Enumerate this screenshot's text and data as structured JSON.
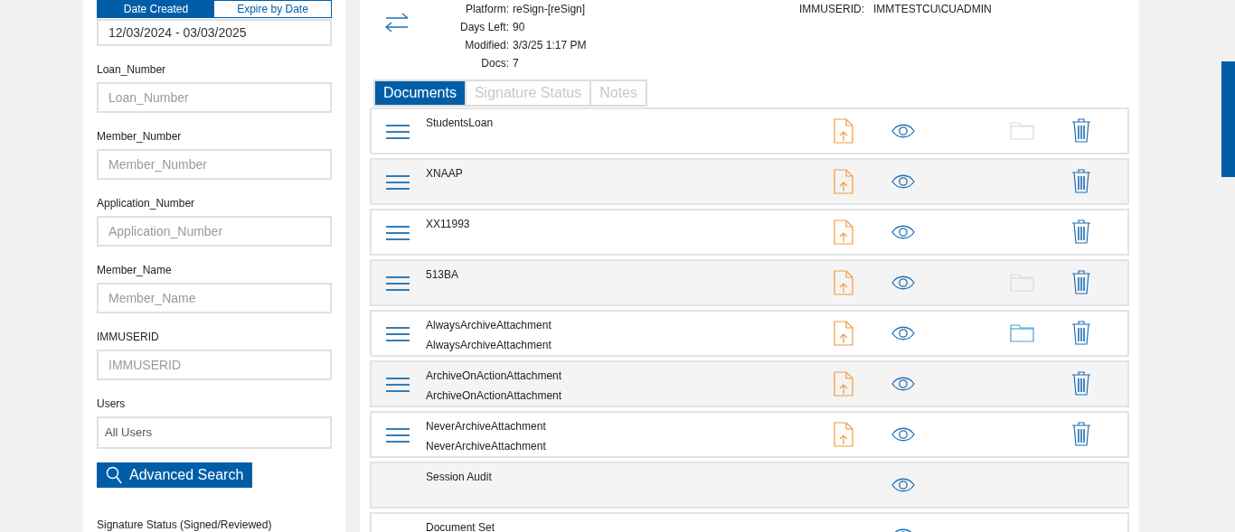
{
  "date_tabs": [
    {
      "label": "Date Created",
      "selected": true
    },
    {
      "label": "Expire by Date",
      "selected": false
    }
  ],
  "date_range": "12/03/2024 - 03/03/2025",
  "filters": [
    {
      "label": "Loan_Number",
      "placeholder": "Loan_Number"
    },
    {
      "label": "Member_Number",
      "placeholder": "Member_Number"
    },
    {
      "label": "Application_Number",
      "placeholder": "Application_Number"
    },
    {
      "label": "Member_Name",
      "placeholder": "Member_Name"
    },
    {
      "label": "IMMUSERID",
      "placeholder": "IMMUSERID"
    }
  ],
  "users": {
    "label": "Users",
    "value": "All Users"
  },
  "advanced_search_button": "Advanced Search",
  "signature_status_label": "Signature Status (Signed/Reviewed)",
  "details": [
    {
      "label": "Platform:",
      "value": "reSign-[reSign]"
    },
    {
      "label": "Days Left:",
      "value": "90"
    },
    {
      "label": "Modified:",
      "value": "3/3/25 1:17 PM"
    },
    {
      "label": "Docs:",
      "value": "7"
    }
  ],
  "user_detail": {
    "label": "IMMUSERID:",
    "value": "IMMTESTCU\\CUADMIN"
  },
  "tabs": [
    {
      "label": "Documents",
      "selected": true
    },
    {
      "label": "Signature Status",
      "selected": false
    },
    {
      "label": "Notes",
      "selected": false
    }
  ],
  "documents": [
    {
      "kind": "document",
      "names": [
        "StudentsLoan"
      ],
      "folder": true,
      "folder_disabled": true
    },
    {
      "kind": "document",
      "names": [
        "XNAAP"
      ],
      "folder": false
    },
    {
      "kind": "document",
      "names": [
        "XX11993"
      ],
      "folder": false
    },
    {
      "kind": "document",
      "names": [
        "513BA"
      ],
      "folder": true,
      "folder_disabled": true
    },
    {
      "kind": "document",
      "names": [
        "AlwaysArchiveAttachment",
        "AlwaysArchiveAttachment"
      ],
      "folder": true,
      "folder_disabled": false
    },
    {
      "kind": "document",
      "names": [
        "ArchiveOnActionAttachment",
        "ArchiveOnActionAttachment"
      ],
      "folder": false
    },
    {
      "kind": "document",
      "names": [
        "NeverArchiveAttachment",
        "NeverArchiveAttachment"
      ],
      "folder": false
    },
    {
      "kind": "audit",
      "names": [
        "Session Audit"
      ],
      "folder": false
    },
    {
      "kind": "audit",
      "names": [
        "Document Set"
      ],
      "folder": false
    }
  ]
}
